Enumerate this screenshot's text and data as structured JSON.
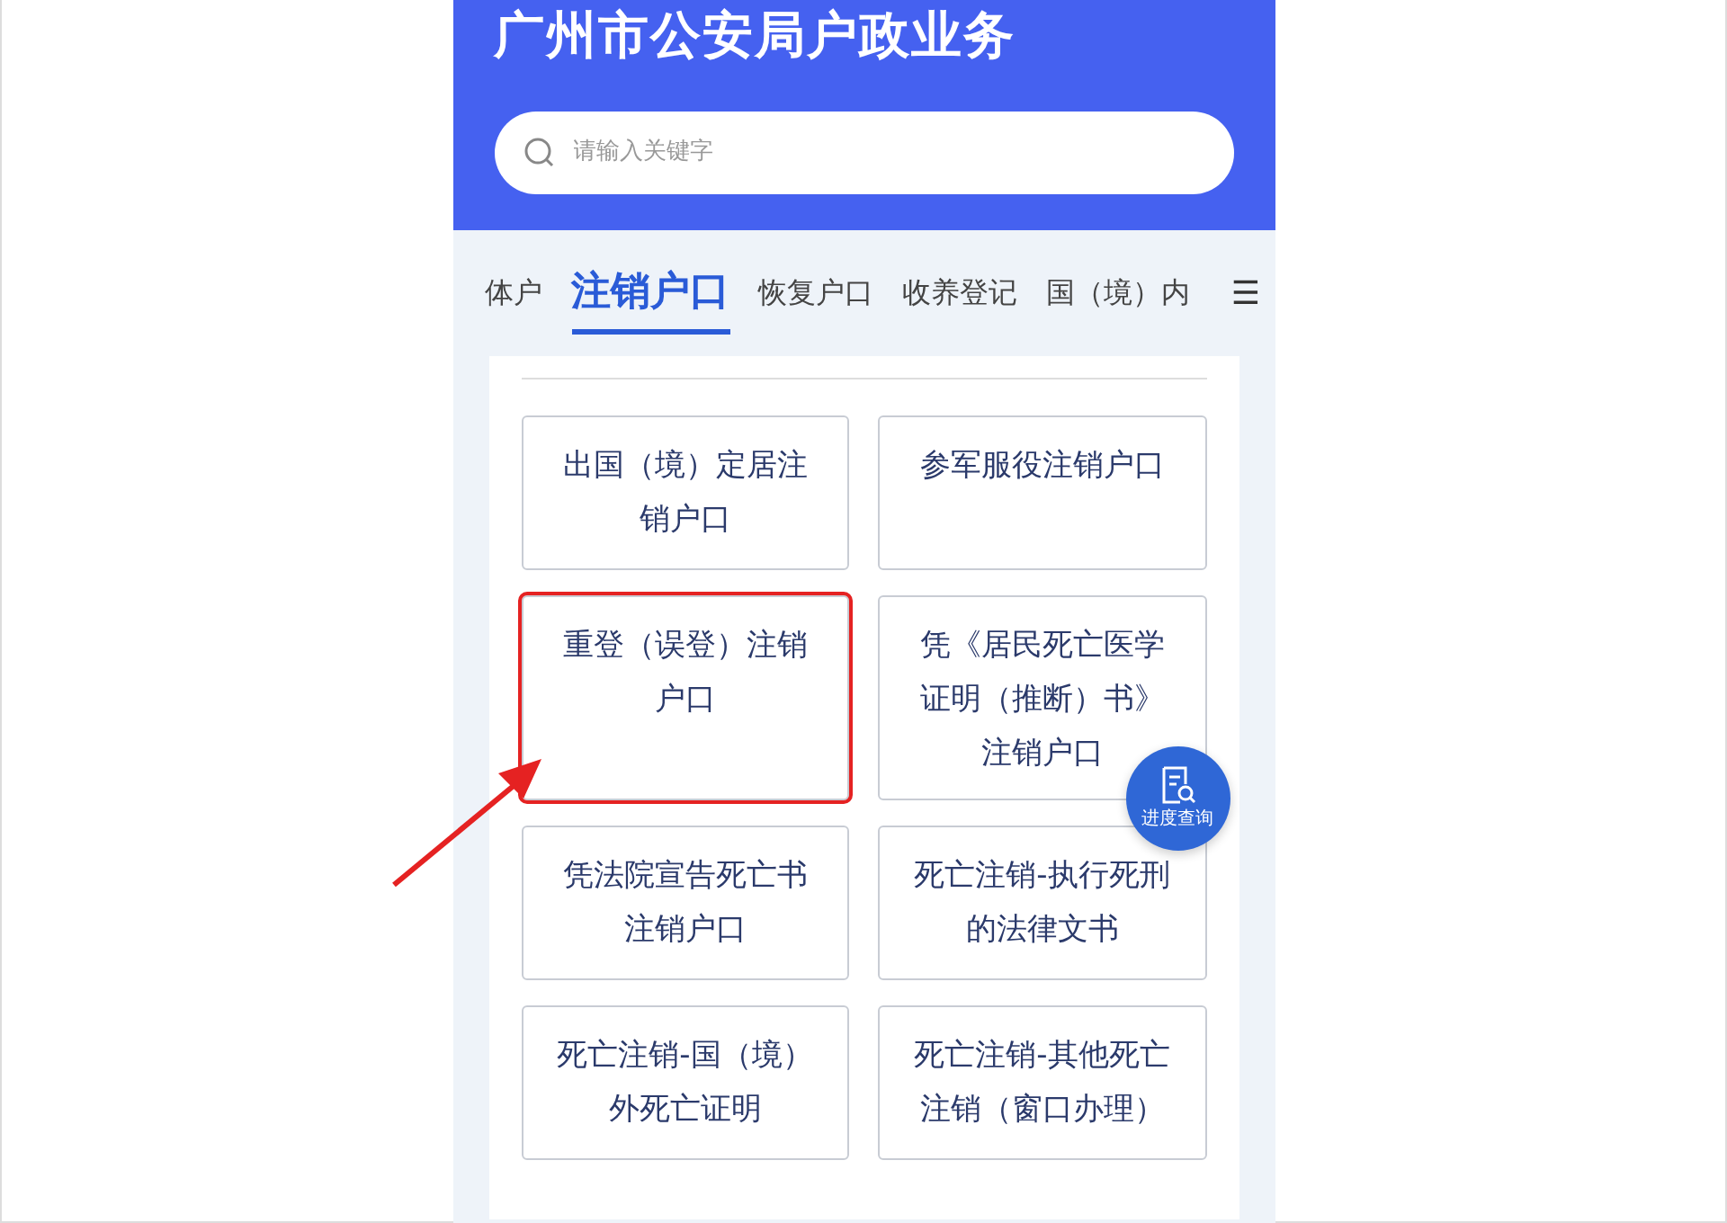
{
  "header": {
    "title": "广州市公安局户政业务",
    "search": {
      "placeholder": "请输入关键字"
    }
  },
  "tabs": [
    {
      "label": "体户",
      "selected": false
    },
    {
      "label": "注销户口",
      "selected": true
    },
    {
      "label": "恢复户口",
      "selected": false
    },
    {
      "label": "收养登记",
      "selected": false
    },
    {
      "label": "国（境）内",
      "selected": false
    }
  ],
  "menu_icon": "☰",
  "items": [
    {
      "label": "出国（境）定居注销户口",
      "highlighted": false
    },
    {
      "label": "参军服役注销户口",
      "highlighted": false
    },
    {
      "label": "重登（误登）注销户口",
      "highlighted": true
    },
    {
      "label": "凭《居民死亡医学证明（推断）书》注销户口",
      "highlighted": false
    },
    {
      "label": "凭法院宣告死亡书注销户口",
      "highlighted": false
    },
    {
      "label": "死亡注销-执行死刑的法律文书",
      "highlighted": false
    },
    {
      "label": "死亡注销-国（境）外死亡证明",
      "highlighted": false
    },
    {
      "label": "死亡注销-其他死亡注销（窗口办理）",
      "highlighted": false
    }
  ],
  "float_button": {
    "label": "进度查询"
  }
}
